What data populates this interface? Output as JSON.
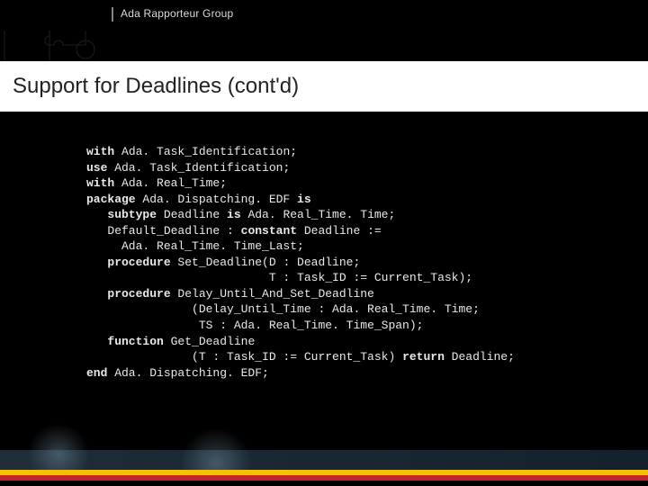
{
  "header": {
    "group": "Ada Rapporteur Group"
  },
  "title": "Support for Deadlines (cont'd)",
  "code": {
    "l1a": "with",
    "l1b": " Ada. Task_Identification;",
    "l2a": "use",
    "l2b": " Ada. Task_Identification;",
    "l3a": "with",
    "l3b": " Ada. Real_Time;",
    "l4a": "package",
    "l4b": " Ada. Dispatching. EDF ",
    "l4c": "is",
    "l5a": "   ",
    "l5b": "subtype",
    "l5c": " Deadline ",
    "l5d": "is",
    "l5e": " Ada. Real_Time. Time;",
    "l6": "   Default_Deadline : ",
    "l6b": "constant",
    "l6c": " Deadline :=",
    "l7": "     Ada. Real_Time. Time_Last;",
    "l8a": "   ",
    "l8b": "procedure",
    "l8c": " Set_Deadline(D : Deadline;",
    "l9": "                          T : Task_ID := Current_Task);",
    "l10a": "   ",
    "l10b": "procedure",
    "l10c": " Delay_Until_And_Set_Deadline",
    "l11": "               (Delay_Until_Time : Ada. Real_Time. Time;",
    "l12": "                TS : Ada. Real_Time. Time_Span);",
    "l13a": "   ",
    "l13b": "function",
    "l13c": " Get_Deadline",
    "l14a": "               (T : Task_ID := Current_Task) ",
    "l14b": "return",
    "l14c": " Deadline;",
    "l15a": "end",
    "l15b": " Ada. Dispatching. EDF;"
  }
}
